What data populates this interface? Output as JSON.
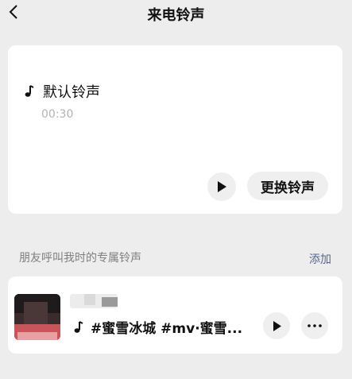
{
  "header": {
    "title": "来电铃声",
    "back_icon": "chevron-left-icon"
  },
  "current": {
    "note_icon": "music-note-icon",
    "name": "默认铃声",
    "duration": "00:30",
    "play_icon": "play-icon",
    "change_label": "更换铃声"
  },
  "friends": {
    "section_label": "朋友呼叫我时的专属铃声",
    "add_label": "添加",
    "items": [
      {
        "avatar": "avatar",
        "contact_name_hidden": true,
        "note_icon": "music-note-icon",
        "song": "#蜜雪冰城 #mv·蜜雪...",
        "play_icon": "play-icon",
        "more_icon": "more-icon"
      }
    ]
  },
  "colors": {
    "background": "#ededed",
    "card": "#ffffff",
    "button_bg": "#efefef",
    "link": "#546793",
    "muted_text": "#7f7f7f"
  }
}
